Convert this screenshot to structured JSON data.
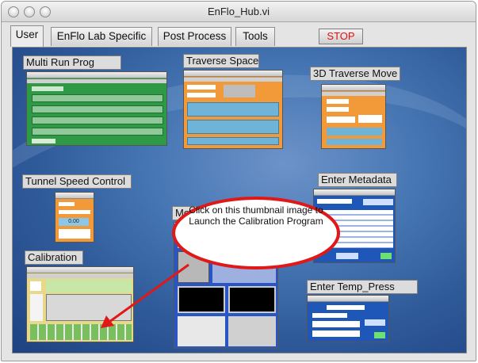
{
  "window": {
    "title": "EnFlo_Hub.vi"
  },
  "tabs": [
    {
      "label": "User",
      "active": true
    },
    {
      "label": "EnFlo Lab Specific",
      "active": false
    },
    {
      "label": "Post Process",
      "active": false
    },
    {
      "label": "Tools",
      "active": false
    }
  ],
  "stop_button": {
    "label": "STOP",
    "color": "#e01010"
  },
  "launchers": {
    "multi_run": {
      "label": "Multi Run Prog",
      "thumb_color": "#2f9a46"
    },
    "traverse_space": {
      "label": "Traverse Space",
      "thumb_color": "#f2993a"
    },
    "traverse_3d": {
      "label": "3D Traverse Move",
      "thumb_color": "#f2993a"
    },
    "tunnel_speed": {
      "label": "Tunnel Speed Control",
      "thumb_color": "#f2993a",
      "speed_value": "0.00"
    },
    "measure": {
      "label": "Measure",
      "thumb_color": "#2a55c4"
    },
    "metadata": {
      "label": "Enter Metadata",
      "thumb_color": "#1f57b8"
    },
    "calibration": {
      "label": "Calibration",
      "thumb_color": "#e8d98a"
    },
    "temp_press": {
      "label": "Enter Temp_Press",
      "thumb_color": "#1f57b8"
    }
  },
  "callout": {
    "text": "Click on this thumbnail image to Launch the Calibration Program",
    "outline_color": "#e01818",
    "arrow_color": "#e01818"
  },
  "icons": [
    "close-icon",
    "minimize-icon",
    "zoom-icon"
  ]
}
